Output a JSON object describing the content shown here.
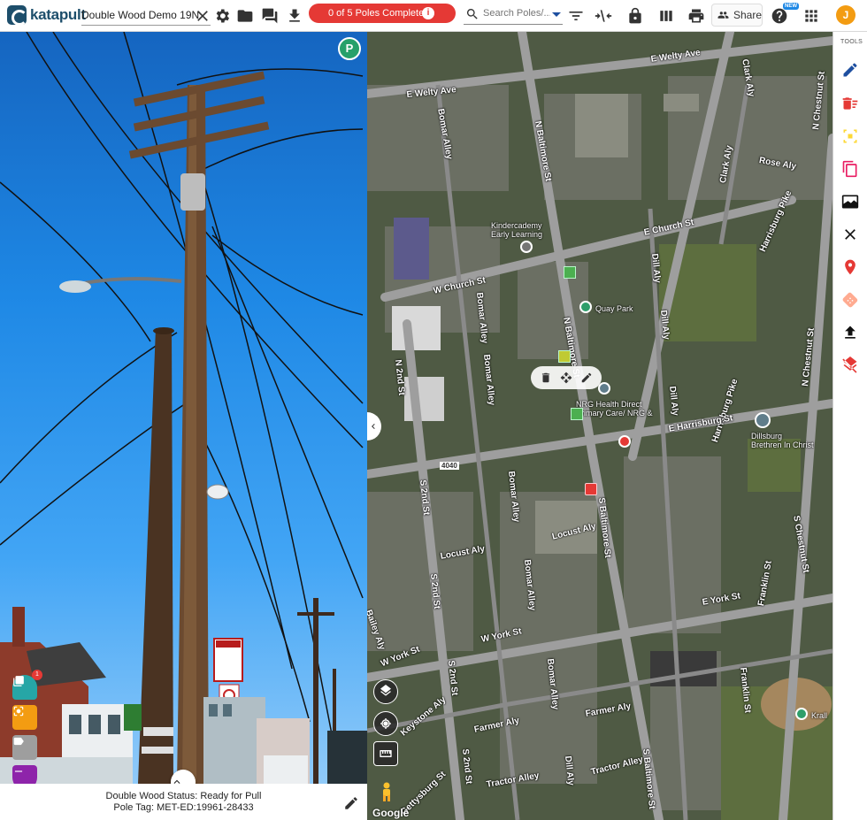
{
  "app": {
    "logo_text": "katapult",
    "job_name": "Double Wood Demo 19N",
    "progress_text": "0 of 5 Poles Completed",
    "progress_info": "i",
    "progress_color": "#e53935",
    "search_placeholder": "Search Poles/...",
    "share_label": "Share",
    "new_badge": "NEW",
    "user_initial": "J",
    "accent_color": "#1d4e6b"
  },
  "photo": {
    "badge_letter": "P",
    "notification_count": "1",
    "status_line": "Double Wood Status: Ready for Pull",
    "tag_line": "Pole Tag: MET-ED:19961-28433",
    "sign_text": "NO EMERGENCY PARKING THIS SIDE OF STREET"
  },
  "map": {
    "streets": {
      "welty_top": "E Welty Ave",
      "welty_left": "E Welty Ave",
      "bomar_alley_1": "Bomar Alley",
      "n_baltimore_1": "N Baltimore St",
      "clark_aly": "Clark Aly",
      "clark_aly_2": "Clark Aly",
      "rose_aly": "Rose Aly",
      "harrisburg_pike_1": "Harrisburg Pike",
      "harrisburg_pike_2": "Harrisburg Pike",
      "n_chestnut_1": "N Chestnut St",
      "n_chestnut_2": "N Chestnut St",
      "e_church": "E Church St",
      "w_church": "W Church St",
      "bomar_alley_2": "Bomar Alley",
      "bomar_alley_3": "Bomar Alley",
      "n_baltimore_2": "N Baltimore St",
      "dill_aly_1": "Dill Aly",
      "dill_aly_2": "Dill Aly",
      "dill_aly_3": "Dill Aly",
      "n_2nd": "N 2nd St",
      "e_harrisburg": "E Harrisburg St",
      "route": "4040",
      "s_2nd_1": "S 2nd St",
      "s_2nd_2": "S 2nd St",
      "s_2nd_3": "S 2nd St",
      "s_2nd_4": "S 2nd St",
      "bomar_alley_4": "Bomar Alley",
      "bomar_alley_5": "Bomar Alley",
      "bomar_alley_6": "Bomar Alley",
      "s_baltimore_1": "S Baltimore St",
      "s_baltimore_2": "S Baltimore St",
      "locust_aly_1": "Locust Aly",
      "locust_aly_2": "Locust Aly",
      "s_chestnut": "S Chestnut St",
      "e_york": "E York St",
      "w_york_1": "W York St",
      "w_york_2": "W York St",
      "franklin_1": "Franklin St",
      "franklin_2": "Franklin St",
      "bailey_aly": "Bailey Aly",
      "keystone_aly": "Keystone Aly",
      "farmer_aly_1": "Farmer Aly",
      "farmer_aly_2": "Farmer Aly",
      "tractor_alley_1": "Tractor Alley",
      "tractor_alley_2": "Tractor Alley",
      "gettysburg": "Gettysburg St",
      "dill_aly_4": "Dill Aly"
    },
    "pois": {
      "kindercademy": "Kindercademy\nEarly Learning",
      "quay_park": "Quay Park",
      "nrg": "NRG Health Direct\nPrimary Care/ NRG &",
      "dillsburg": "Dillsburg\nBrethren In Christ",
      "krall": "Krall"
    },
    "google_label": "Google",
    "imagery_style": "satellite"
  },
  "tools": {
    "label": "TOOLS",
    "items": [
      "pencil-icon",
      "delete-multiple-icon",
      "select-box-icon",
      "copy-icon",
      "map-image-icon",
      "close-icon",
      "map-marker-icon",
      "bandage-icon",
      "upload-icon",
      "layers-off-icon"
    ]
  }
}
